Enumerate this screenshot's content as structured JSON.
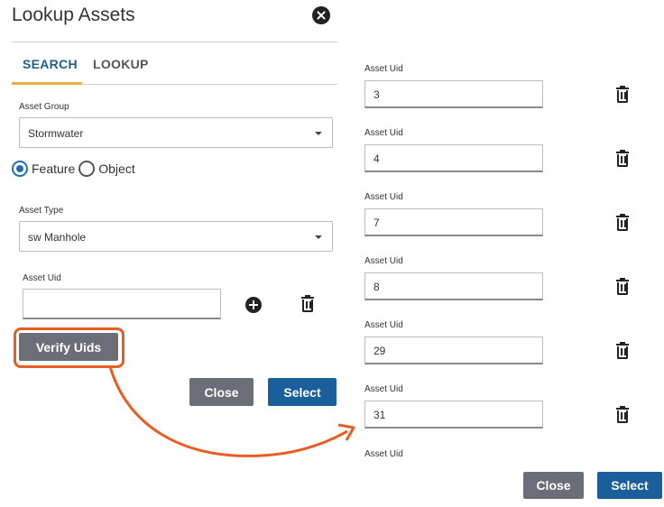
{
  "dialog": {
    "title": "Lookup Assets"
  },
  "tabs": [
    {
      "label": "SEARCH",
      "active": true
    },
    {
      "label": "LOOKUP",
      "active": false
    }
  ],
  "form": {
    "asset_group_label": "Asset Group",
    "asset_group_value": "Stormwater",
    "radio_options": [
      {
        "label": "Feature",
        "checked": true
      },
      {
        "label": "Object",
        "checked": false
      }
    ],
    "asset_type_label": "Asset Type",
    "asset_type_value": "sw Manhole",
    "asset_uid_label": "Asset Uid",
    "asset_uid_value": ""
  },
  "buttons": {
    "verify_label": "Verify Uids",
    "close_label": "Close",
    "select_label": "Select"
  },
  "uid_list": {
    "label": "Asset Uid",
    "values": [
      "3",
      "4",
      "7",
      "8",
      "29",
      "31"
    ],
    "trailing_label": "Asset Uid"
  },
  "colors": {
    "tab_active": "#1f5d8e",
    "tab_underline": "#e9b23a",
    "button_gray": "#6b6e78",
    "button_blue": "#1a5f9c",
    "highlight": "#e85d22"
  },
  "icons": [
    "close-icon",
    "chevron-down-icon",
    "add-icon",
    "trash-icon"
  ]
}
